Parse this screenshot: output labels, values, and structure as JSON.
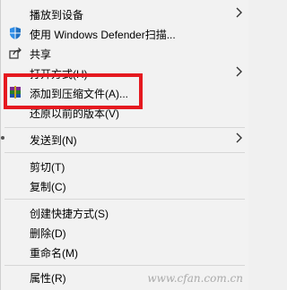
{
  "menu": {
    "items": [
      {
        "label": "播放到设备",
        "submenu": true
      },
      {
        "label": "使用 Windows Defender扫描..."
      },
      {
        "label": "共享"
      },
      {
        "label": "打开方式(H)",
        "submenu": true
      },
      {
        "label": "添加到压缩文件(A)..."
      },
      {
        "label": "还原以前的版本(V)"
      },
      {
        "label": "发送到(N)",
        "submenu": true
      },
      {
        "label": "剪切(T)"
      },
      {
        "label": "复制(C)"
      },
      {
        "label": "创建快捷方式(S)"
      },
      {
        "label": "删除(D)"
      },
      {
        "label": "重命名(M)"
      },
      {
        "label": "属性(R)"
      }
    ]
  },
  "watermark": "www.cfan.com.cn",
  "colors": {
    "highlight_box": "#e5191f",
    "menu_background": "#f2f2f2",
    "separator": "#d7d7d7"
  }
}
